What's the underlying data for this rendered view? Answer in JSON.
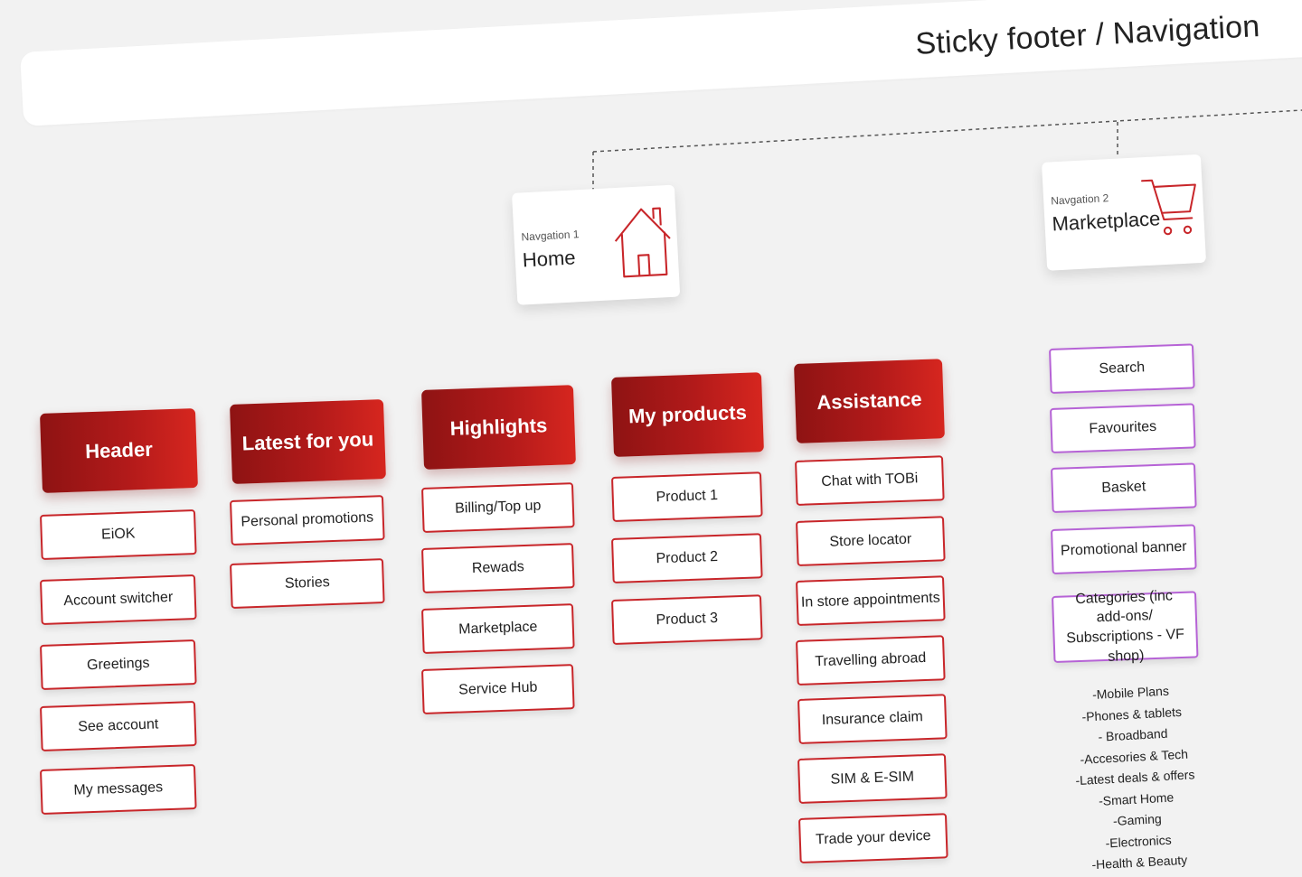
{
  "page_title": "Sticky footer / Navigation",
  "navigations": [
    {
      "sub": "Navgation 1",
      "title": "Home",
      "icon": "home-icon"
    },
    {
      "sub": "Navgation 2",
      "title": "Marketplace",
      "icon": "shopping-cart-icon"
    }
  ],
  "columns": [
    {
      "header": "Header",
      "items": [
        "EiOK",
        "Account switcher",
        "Greetings",
        "See account",
        "My messages"
      ]
    },
    {
      "header": "Latest for you",
      "items": [
        "Personal promotions",
        "Stories"
      ]
    },
    {
      "header": "Highlights",
      "items": [
        "Billing/Top up",
        "Rewads",
        "Marketplace",
        "Service Hub"
      ]
    },
    {
      "header": "My products",
      "items": [
        "Product 1",
        "Product 2",
        "Product 3"
      ]
    },
    {
      "header": "Assistance",
      "items": [
        "Chat with TOBi",
        "Store locator",
        "In store appointments",
        "Travelling abroad",
        "Insurance claim",
        "SIM & E-SIM",
        "Trade your device"
      ]
    }
  ],
  "marketplace_items": [
    "Search",
    "Favourites",
    "Basket",
    "Promotional banner",
    "Categories (inc add-ons/ Subscriptions - VF shop)"
  ],
  "marketplace_categories": [
    "-Mobile Plans",
    "-Phones & tablets",
    "- Broadband",
    "-Accesories & Tech",
    "-Latest deals & offers",
    "-Smart Home",
    "-Gaming",
    "-Electronics",
    "-Health & Beauty"
  ],
  "colors": {
    "primary_red": "#c8262a",
    "header_gradient_dark": "#8e1313",
    "header_gradient_light": "#d6261f",
    "marketplace_border": "#b663d6",
    "background": "#f2f2f2"
  }
}
